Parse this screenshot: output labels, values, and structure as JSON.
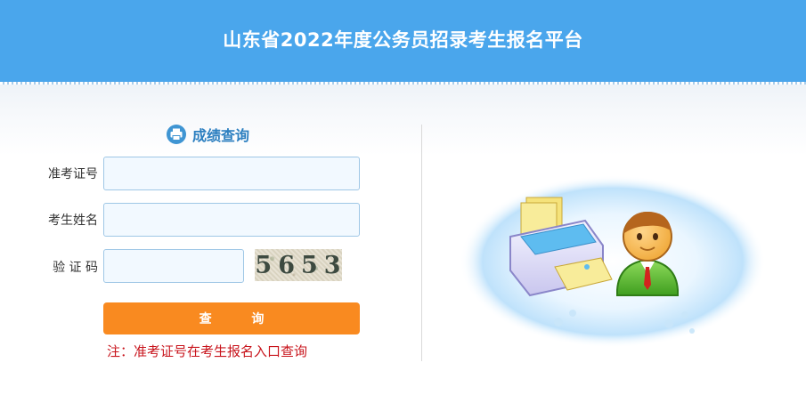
{
  "header": {
    "title": "山东省2022年度公务员招录考生报名平台"
  },
  "form": {
    "title": "成绩查询",
    "icon": "printer-icon",
    "fields": {
      "ticket_label": "准考证号",
      "ticket_value": "",
      "name_label": "考生姓名",
      "name_value": "",
      "code_label": "验 证 码",
      "code_value": ""
    },
    "captcha_text": "5653",
    "submit_label": "查 询",
    "note": "注：准考证号在考生报名入口查询"
  },
  "colors": {
    "header": "#4aa6ec",
    "button": "#f98a20",
    "title": "#2c7fc0",
    "note": "#c8141c"
  },
  "illustration": {
    "icons": [
      "printer-icon",
      "user-avatar-icon"
    ]
  }
}
